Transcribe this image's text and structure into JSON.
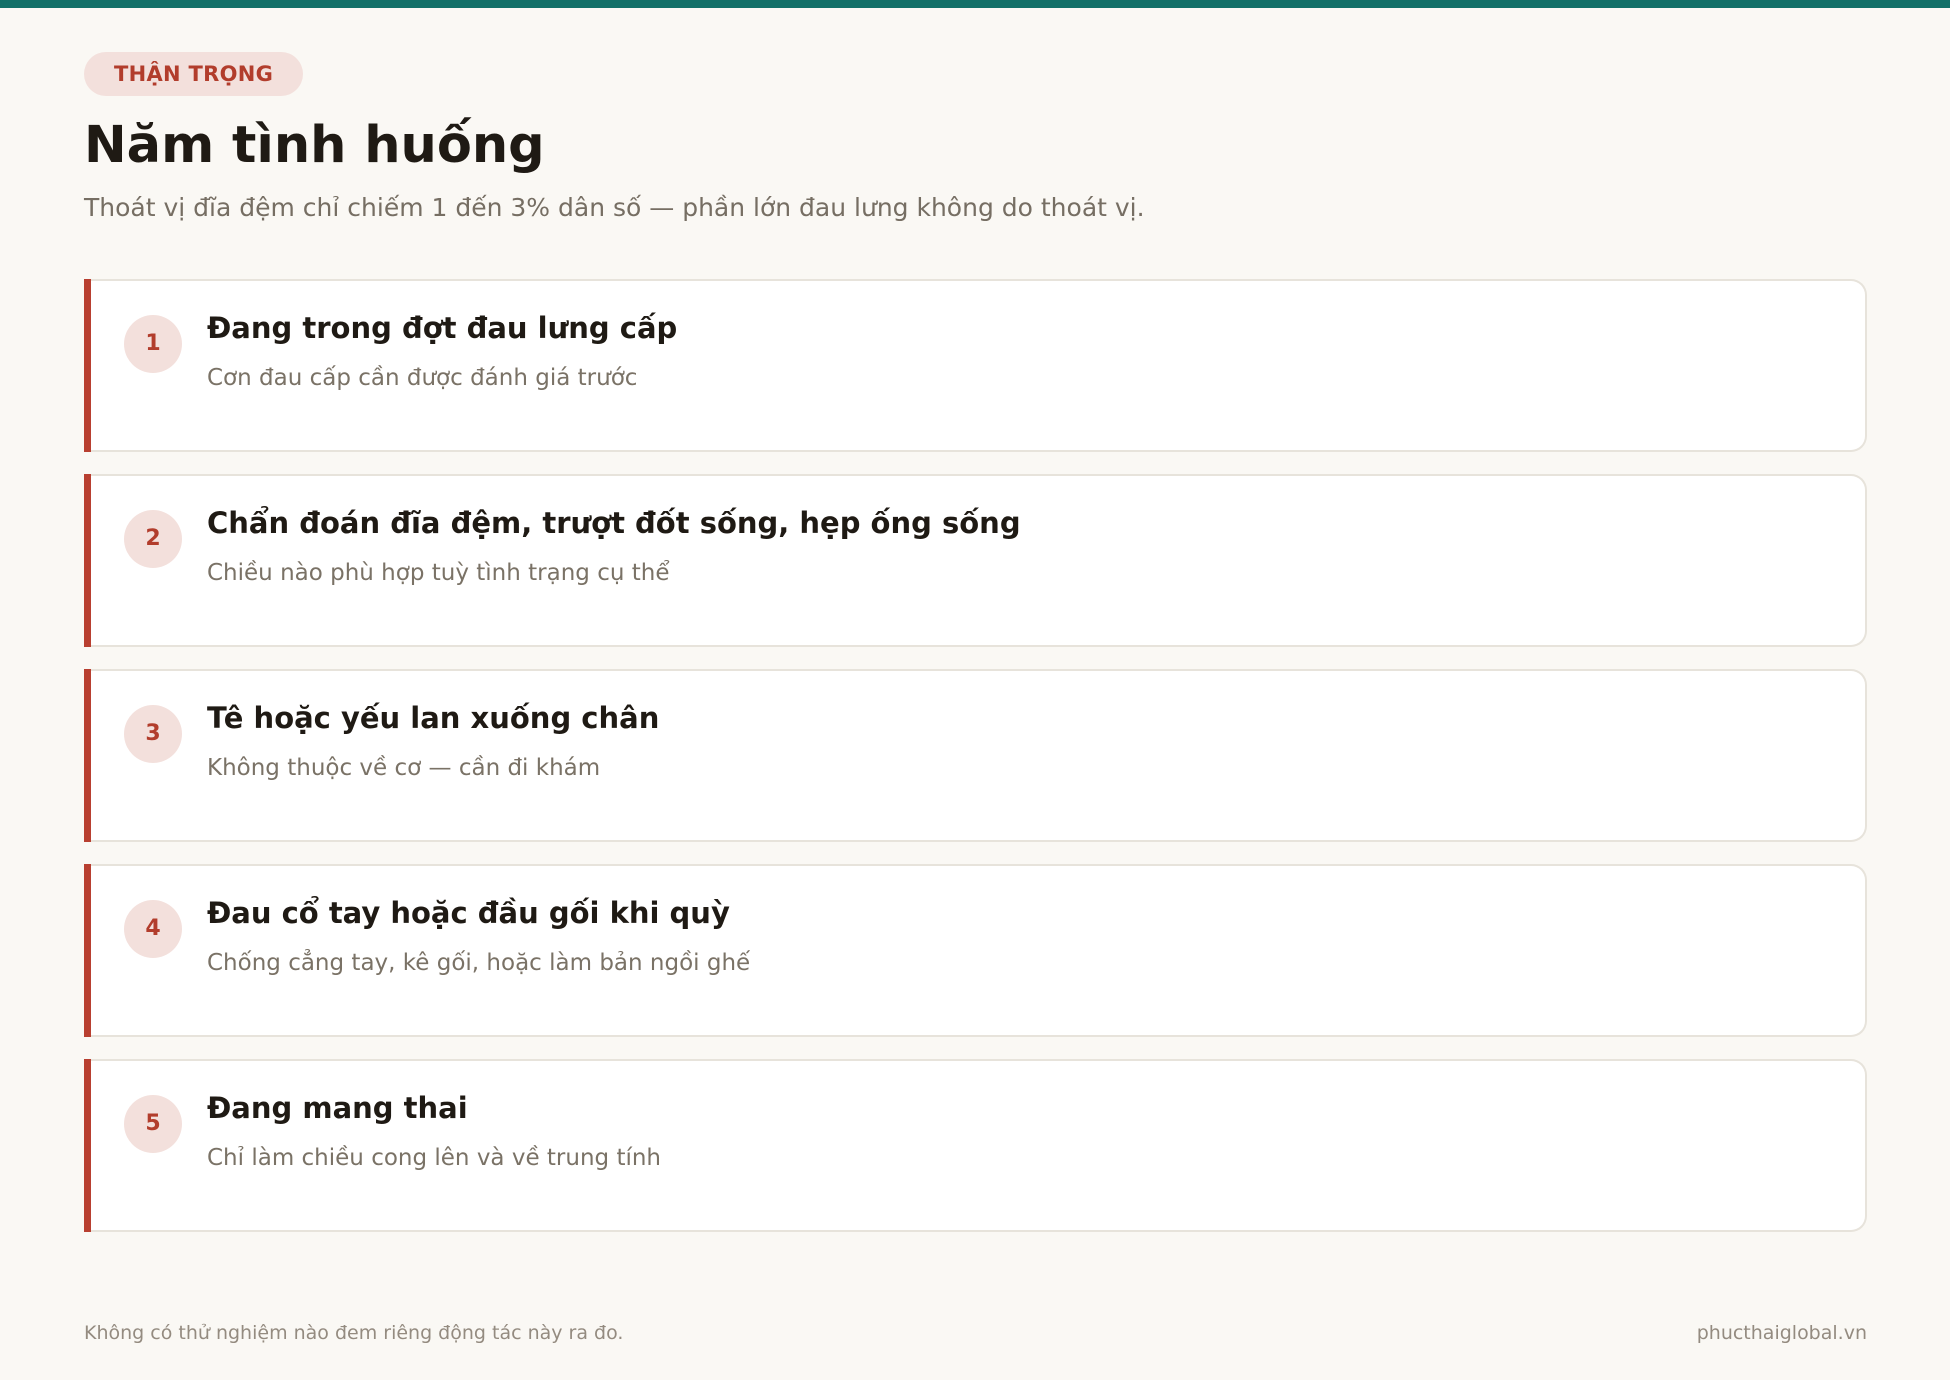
{
  "header": {
    "badge": "THẬN TRỌNG",
    "title": "Năm tình huống",
    "subtitle": "Thoát vị đĩa đệm chỉ chiếm 1 đến 3% dân số — phần lớn đau lưng không do thoát vị."
  },
  "items": [
    {
      "number": "1",
      "title": "Đang trong đợt đau lưng cấp",
      "description": "Cơn đau cấp cần được đánh giá trước"
    },
    {
      "number": "2",
      "title": "Chẩn đoán đĩa đệm, trượt đốt sống, hẹp ống sống",
      "description": "Chiều nào phù hợp tuỳ tình trạng cụ thể"
    },
    {
      "number": "3",
      "title": "Tê hoặc yếu lan xuống chân",
      "description": "Không thuộc về cơ — cần đi khám"
    },
    {
      "number": "4",
      "title": "Đau cổ tay hoặc đầu gối khi quỳ",
      "description": "Chống cẳng tay, kê gối, hoặc làm bản ngồi ghế"
    },
    {
      "number": "5",
      "title": "Đang mang thai",
      "description": "Chỉ làm chiều cong lên và về trung tính"
    }
  ],
  "footer": {
    "note": "Không có thử nghiệm nào đem riêng động tác này ra đo.",
    "site": "phucthaiglobal.vn"
  },
  "colors": {
    "top_bar": "#127068",
    "accent": "#b83f30",
    "badge_bg": "#f3e0dc",
    "background": "#faf8f4"
  }
}
